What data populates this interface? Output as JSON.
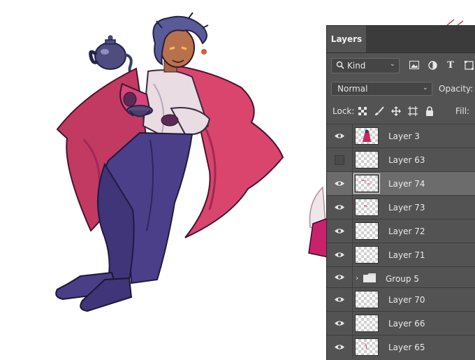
{
  "panel": {
    "tab_label": "Layers",
    "filter": {
      "kind_label": "Kind",
      "icons": [
        "image-filter-icon",
        "adjustment-filter-icon",
        "type-filter-icon",
        "shape-filter-icon"
      ]
    },
    "blend_mode": "Normal",
    "opacity_label": "Opacity:",
    "lock_label": "Lock:",
    "lock_icons": [
      "lock-transparent-icon",
      "lock-brush-icon",
      "lock-move-icon",
      "lock-artboard-icon",
      "lock-all-icon"
    ],
    "fill_label": "Fill:"
  },
  "layers": [
    {
      "name": "Layer 3",
      "visible": true,
      "selected": false,
      "thumb": "figure"
    },
    {
      "name": "Layer 63",
      "visible": false,
      "selected": false,
      "thumb": "empty"
    },
    {
      "name": "Layer 74",
      "visible": true,
      "selected": true,
      "thumb": "sketch"
    },
    {
      "name": "Layer 73",
      "visible": true,
      "selected": false,
      "thumb": "sketch"
    },
    {
      "name": "Layer 72",
      "visible": true,
      "selected": false,
      "thumb": "empty"
    },
    {
      "name": "Layer 71",
      "visible": true,
      "selected": false,
      "thumb": "empty"
    },
    {
      "name": "Group 5",
      "visible": true,
      "selected": false,
      "type": "group"
    },
    {
      "name": "Layer 70",
      "visible": true,
      "selected": false,
      "thumb": "empty"
    },
    {
      "name": "Layer 66",
      "visible": true,
      "selected": false,
      "thumb": "empty"
    },
    {
      "name": "Layer 65",
      "visible": true,
      "selected": false,
      "thumb": "sketch"
    }
  ],
  "colors": {
    "panel_bg": "#535353",
    "selected_row": "#6c6c6c",
    "coat": "#d9456d",
    "pants": "#4b3f8a",
    "hair": "#5a5a96"
  }
}
